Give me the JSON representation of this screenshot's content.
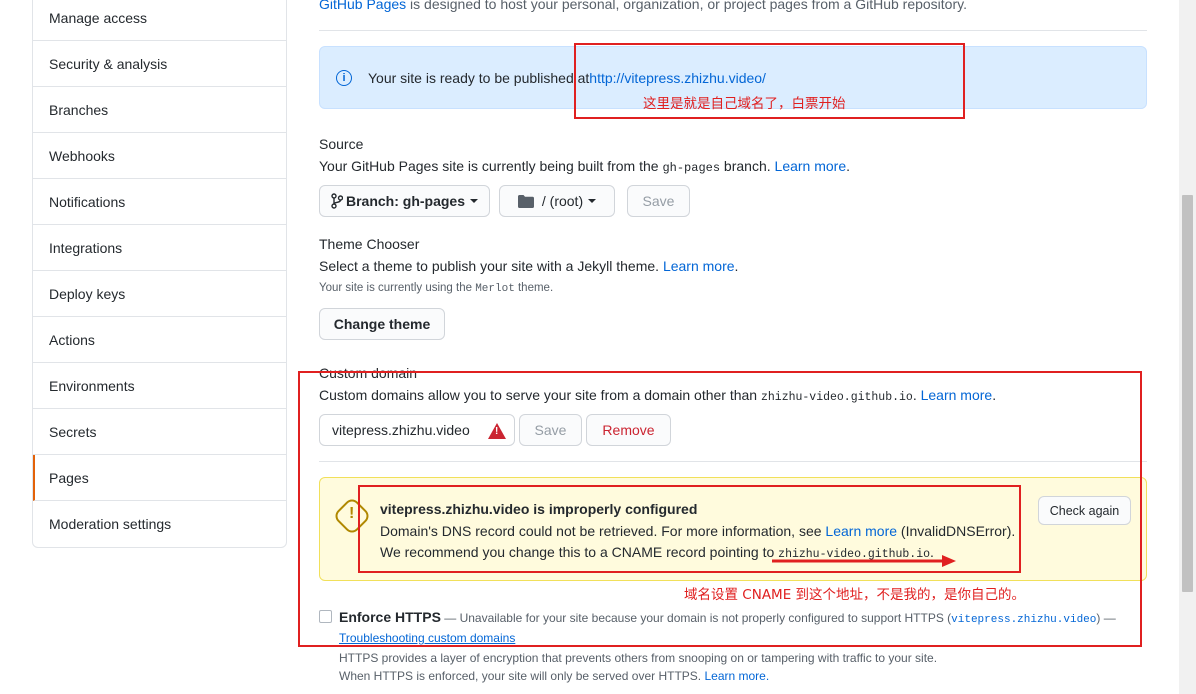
{
  "sidebar": {
    "items": [
      {
        "label": "Manage access"
      },
      {
        "label": "Security & analysis"
      },
      {
        "label": "Branches"
      },
      {
        "label": "Webhooks"
      },
      {
        "label": "Notifications"
      },
      {
        "label": "Integrations"
      },
      {
        "label": "Deploy keys"
      },
      {
        "label": "Actions"
      },
      {
        "label": "Environments"
      },
      {
        "label": "Secrets"
      },
      {
        "label": "Pages",
        "selected": true
      },
      {
        "label": "Moderation settings"
      }
    ]
  },
  "intro": {
    "link": "GitHub Pages",
    "text": " is designed to host your personal, organization, or project pages from a GitHub repository."
  },
  "ready_flash": {
    "text": "Your site is ready to be published at ",
    "url": "http://vitepress.zhizhu.video/"
  },
  "source": {
    "title": "Source",
    "desc_pre": "Your GitHub Pages site is currently being built from the ",
    "branch_code": "gh-pages",
    "desc_post": " branch. ",
    "learn_more": "Learn more",
    "branch_button": "Branch: gh-pages",
    "folder_button": "/ (root)",
    "save": "Save"
  },
  "theme": {
    "title": "Theme Chooser",
    "desc": "Select a theme to publish your site with a Jekyll theme. ",
    "learn_more": "Learn more",
    "note_pre": "Your site is currently using the ",
    "theme_name": "Merlot",
    "note_post": " theme.",
    "change_button": "Change theme"
  },
  "custom_domain": {
    "title": "Custom domain",
    "desc_pre": "Custom domains allow you to serve your site from a domain other than ",
    "default_domain": "zhizhu-video.github.io",
    "desc_post": ". ",
    "learn_more": "Learn more",
    "input_value": "vitepress.zhizhu.video",
    "save": "Save",
    "remove": "Remove"
  },
  "dns_warning": {
    "title": "vitepress.zhizhu.video is improperly configured",
    "line1_pre": "Domain's DNS record could not be retrieved. For more information, see ",
    "line1_link": "Learn more",
    "line1_post": " (InvalidDNSError).",
    "line2_pre": "We recommend you change this to a CNAME record pointing to ",
    "line2_code": "zhizhu-video.github.io",
    "line2_post": ".",
    "check_again": "Check again"
  },
  "https": {
    "label": "Enforce HTTPS",
    "desc_pre": " — Unavailable for your site because your domain is not properly configured to support HTTPS (",
    "desc_code": "vitepress.zhizhu.video",
    "desc_post": ") —",
    "troubleshoot": "Troubleshooting custom domains",
    "info1": "HTTPS provides a layer of encryption that prevents others from snooping on or tampering with traffic to your site.",
    "info2_pre": "When HTTPS is enforced, your site will only be served over HTTPS. ",
    "info2_link": "Learn more."
  },
  "annotations": {
    "note1": "这里是就是自己域名了，白票开始",
    "note2": "域名设置 CNAME 到这个地址，不是我的，是你自己的。",
    "color": "#e02020"
  }
}
